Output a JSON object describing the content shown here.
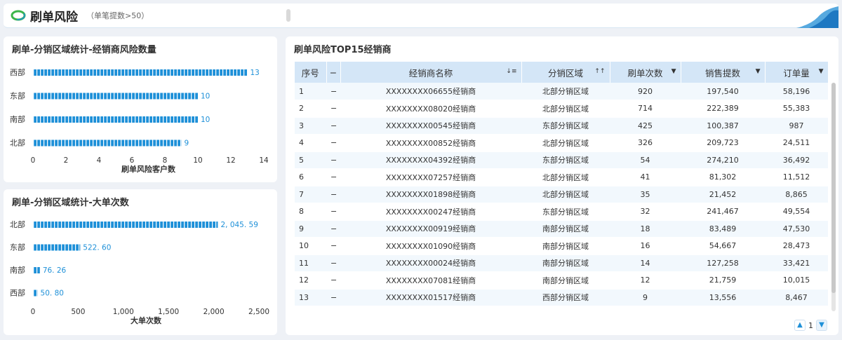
{
  "header": {
    "title": "刷单风险",
    "subtitle": "（单笔提数>50）"
  },
  "colors": {
    "bar": "#1e90d8",
    "header_bg": "#d4e6f7",
    "stripe": "#f2f8fd"
  },
  "chart_data": [
    {
      "type": "bar",
      "orientation": "horizontal",
      "title": "刷单-分销区域统计-经销商风险数量",
      "categories": [
        "西部",
        "东部",
        "南部",
        "北部"
      ],
      "values": [
        13,
        10,
        10,
        9
      ],
      "value_labels": [
        "13",
        "10",
        "10",
        "9"
      ],
      "xlabel": "刷单风险客户数",
      "xlim": [
        0,
        14
      ],
      "ticks": [
        "0",
        "2",
        "4",
        "6",
        "8",
        "10",
        "12",
        "14"
      ],
      "tick_values": [
        0,
        2,
        4,
        6,
        8,
        10,
        12,
        14
      ]
    },
    {
      "type": "bar",
      "orientation": "horizontal",
      "title": "刷单-分销区域统计-大单次数",
      "categories": [
        "北部",
        "东部",
        "南部",
        "西部"
      ],
      "values": [
        2045.59,
        522.6,
        76.26,
        50.8
      ],
      "value_labels": [
        "2, 045. 59",
        "522. 60",
        "76. 26",
        "50. 80"
      ],
      "xlabel": "大单次数",
      "xlim": [
        0,
        2500
      ],
      "ticks": [
        "0",
        "500",
        "1,000",
        "1,500",
        "2,000",
        "2,500"
      ],
      "tick_values": [
        0,
        500,
        1000,
        1500,
        2000,
        2500
      ]
    }
  ],
  "table": {
    "title": "刷单风险TOP15经销商",
    "columns": {
      "seq": "序号",
      "dash": "−",
      "name": "经销商名称",
      "region": "分销区域",
      "count": "刷单次数",
      "sales": "销售提数",
      "orders": "订单量"
    },
    "sort_icons": {
      "name": "↓≡",
      "region": "↑↑",
      "count": "▼",
      "sales": "▼",
      "orders": "▼"
    },
    "rows": [
      {
        "seq": "1",
        "dash": "−",
        "name": "XXXXXXXX06655经销商",
        "region": "北部分销区域",
        "count": "920",
        "sales": "197,540",
        "orders": "58,196"
      },
      {
        "seq": "2",
        "dash": "−",
        "name": "XXXXXXXX08020经销商",
        "region": "北部分销区域",
        "count": "714",
        "sales": "222,389",
        "orders": "55,383"
      },
      {
        "seq": "3",
        "dash": "−",
        "name": "XXXXXXXX00545经销商",
        "region": "东部分销区域",
        "count": "425",
        "sales": "100,387",
        "orders": "987"
      },
      {
        "seq": "4",
        "dash": "−",
        "name": "XXXXXXXX00852经销商",
        "region": "北部分销区域",
        "count": "326",
        "sales": "209,723",
        "orders": "24,511"
      },
      {
        "seq": "5",
        "dash": "−",
        "name": "XXXXXXXX04392经销商",
        "region": "东部分销区域",
        "count": "54",
        "sales": "274,210",
        "orders": "36,492"
      },
      {
        "seq": "6",
        "dash": "−",
        "name": "XXXXXXXX07257经销商",
        "region": "北部分销区域",
        "count": "41",
        "sales": "81,302",
        "orders": "11,512"
      },
      {
        "seq": "7",
        "dash": "−",
        "name": "XXXXXXXX01898经销商",
        "region": "北部分销区域",
        "count": "35",
        "sales": "21,452",
        "orders": "8,865"
      },
      {
        "seq": "8",
        "dash": "−",
        "name": "XXXXXXXX00247经销商",
        "region": "东部分销区域",
        "count": "32",
        "sales": "241,467",
        "orders": "49,554"
      },
      {
        "seq": "9",
        "dash": "−",
        "name": "XXXXXXXX00919经销商",
        "region": "南部分销区域",
        "count": "18",
        "sales": "83,489",
        "orders": "47,530"
      },
      {
        "seq": "10",
        "dash": "−",
        "name": "XXXXXXXX01090经销商",
        "region": "南部分销区域",
        "count": "16",
        "sales": "54,667",
        "orders": "28,473"
      },
      {
        "seq": "11",
        "dash": "−",
        "name": "XXXXXXXX00024经销商",
        "region": "南部分销区域",
        "count": "14",
        "sales": "127,258",
        "orders": "33,421"
      },
      {
        "seq": "12",
        "dash": "−",
        "name": "XXXXXXXX07081经销商",
        "region": "南部分销区域",
        "count": "12",
        "sales": "21,759",
        "orders": "10,015"
      },
      {
        "seq": "13",
        "dash": "−",
        "name": "XXXXXXXX01517经销商",
        "region": "西部分销区域",
        "count": "9",
        "sales": "13,556",
        "orders": "8,467"
      }
    ]
  },
  "pagination": {
    "page": "1"
  }
}
